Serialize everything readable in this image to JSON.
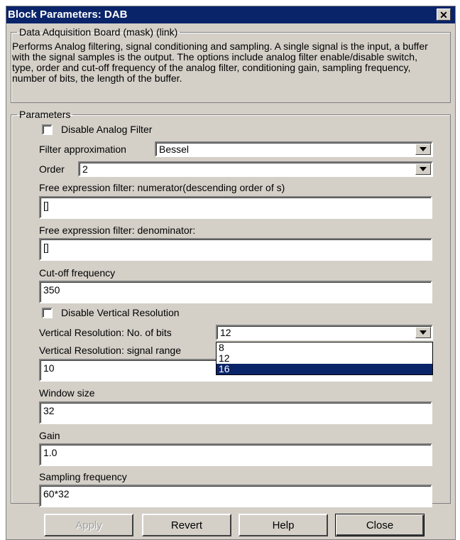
{
  "window": {
    "title": "Block Parameters: DAB",
    "close_glyph": "✕"
  },
  "mask_group": {
    "legend": "Data Adquisition Board (mask) (link)",
    "description": "Performs Analog filtering, signal conditioning and sampling. A single signal is the input, a buffer with the signal samples is the output. The options include analog filter enable/disable switch, type, order and cut-off frequency of the analog filter, conditioning gain, sampling frequency, number of bits, the length of the buffer."
  },
  "parameters": {
    "legend": "Parameters",
    "disable_analog_filter": {
      "label": "Disable Analog Filter",
      "checked": false
    },
    "filter_approximation": {
      "label": "Filter approximation",
      "value": "Bessel"
    },
    "order": {
      "label": "Order",
      "value": "2"
    },
    "numerator": {
      "label": "Free expression filter: numerator(descending order of s)",
      "value": "[]"
    },
    "denominator": {
      "label": "Free expression filter: denominator:",
      "value": "[]"
    },
    "cutoff": {
      "label": "Cut-off frequency",
      "value": "350"
    },
    "disable_vertical_resolution": {
      "label": "Disable Vertical Resolution",
      "checked": false
    },
    "vr_bits": {
      "label": "Vertical Resolution: No. of bits",
      "value": "12",
      "options": [
        "8",
        "12",
        "16"
      ],
      "highlighted": "16"
    },
    "vr_range": {
      "label": "Vertical Resolution: signal range",
      "value": "10"
    },
    "window_size": {
      "label": "Window size",
      "value": "32"
    },
    "gain": {
      "label": "Gain",
      "value": "1.0"
    },
    "sampling_frequency": {
      "label": "Sampling frequency",
      "value": "60*32"
    }
  },
  "buttons": {
    "apply": "Apply",
    "revert": "Revert",
    "help": "Help",
    "close": "Close"
  },
  "icons": {
    "dropdown": "chevron-down-icon",
    "close": "close-icon"
  }
}
